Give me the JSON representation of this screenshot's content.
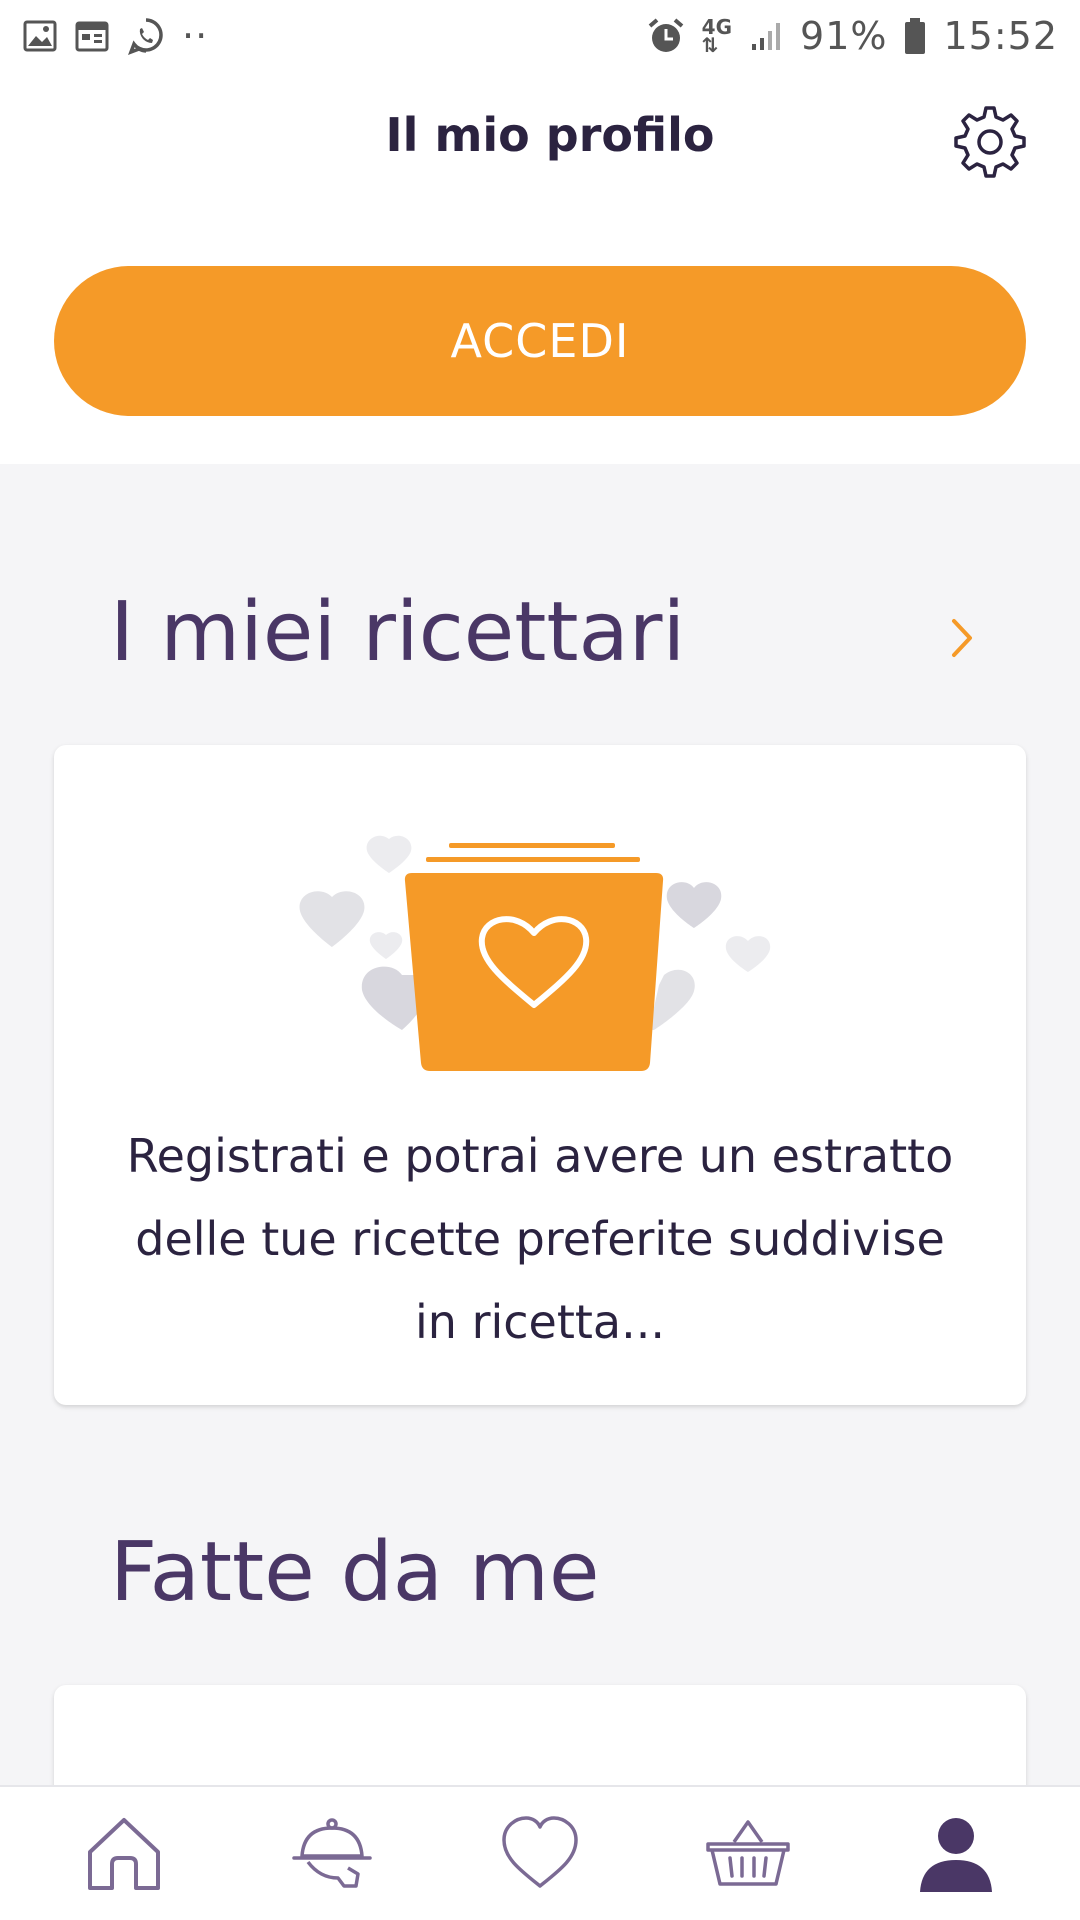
{
  "status_bar": {
    "battery": "91%",
    "time": "15:52",
    "network": "4G",
    "dots": "··",
    "icons": [
      "gallery-icon",
      "calendar-icon",
      "whatsapp-icon",
      "alarm-icon",
      "signal-icon",
      "battery-icon"
    ]
  },
  "header": {
    "title": "Il mio profilo",
    "settings_icon": "gear-icon"
  },
  "login": {
    "label": "ACCEDI"
  },
  "recipes_section": {
    "title": "I miei ricettari",
    "card_text": "Registrati e potrai avere un estratto delle tue ricette preferite suddivise in ricetta..."
  },
  "made_section": {
    "title": "Fatte da me"
  },
  "bottom_nav": {
    "items": [
      {
        "icon": "home-icon",
        "active": false
      },
      {
        "icon": "cloche-icon",
        "active": false
      },
      {
        "icon": "heart-icon",
        "active": false
      },
      {
        "icon": "basket-icon",
        "active": false
      },
      {
        "icon": "profile-icon",
        "active": true
      }
    ]
  },
  "colors": {
    "accent": "#f59a28",
    "title": "#2b2340",
    "section_title": "#4a3766",
    "nav_inactive": "#7b6a94",
    "nav_active": "#4a3766",
    "background": "#f5f5f7"
  }
}
